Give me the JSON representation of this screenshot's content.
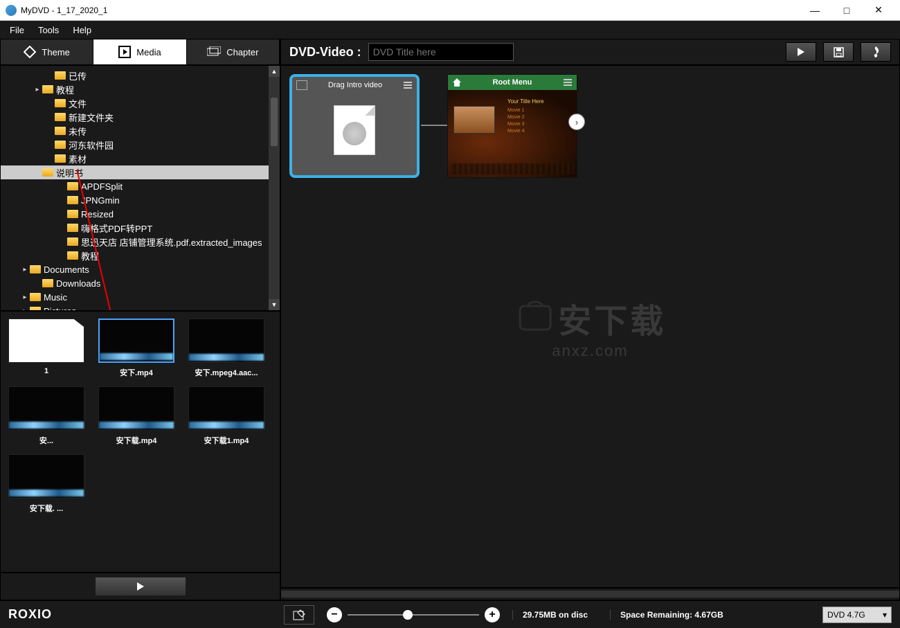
{
  "window": {
    "title": "MyDVD - 1_17_2020_1"
  },
  "menu": {
    "file": "File",
    "tools": "Tools",
    "help": "Help"
  },
  "tabs": {
    "theme": "Theme",
    "media": "Media",
    "chapter": "Chapter"
  },
  "tree": {
    "items": [
      {
        "indent": 3,
        "expand": "",
        "label": "已传"
      },
      {
        "indent": 2,
        "expand": "▸",
        "label": "教程"
      },
      {
        "indent": 3,
        "expand": "",
        "label": "文件"
      },
      {
        "indent": 3,
        "expand": "",
        "label": "新建文件夹"
      },
      {
        "indent": 3,
        "expand": "",
        "label": "未传"
      },
      {
        "indent": 3,
        "expand": "",
        "label": "河东软件园"
      },
      {
        "indent": 3,
        "expand": "",
        "label": "素材"
      },
      {
        "indent": 2,
        "expand": "▾",
        "label": "说明书",
        "selected": true
      },
      {
        "indent": 4,
        "expand": "",
        "label": "APDFSplit"
      },
      {
        "indent": 4,
        "expand": "",
        "label": "JPNGmin"
      },
      {
        "indent": 4,
        "expand": "",
        "label": "Resized"
      },
      {
        "indent": 4,
        "expand": "",
        "label": "嗨格式PDF转PPT"
      },
      {
        "indent": 4,
        "expand": "",
        "label": "思迅天店 店铺管理系统.pdf.extracted_images"
      },
      {
        "indent": 4,
        "expand": "",
        "label": "教程"
      },
      {
        "indent": 1,
        "expand": "▸",
        "label": "Documents"
      },
      {
        "indent": 2,
        "expand": "",
        "label": "Downloads"
      },
      {
        "indent": 1,
        "expand": "▸",
        "label": "Music"
      },
      {
        "indent": 1,
        "expand": "▸",
        "label": "Pictures"
      }
    ]
  },
  "media": {
    "items": [
      {
        "name": "1",
        "kind": "doc"
      },
      {
        "name": "安下.mp4",
        "kind": "video",
        "selected": true
      },
      {
        "name": "安下.mpeg4.aac...",
        "kind": "video"
      },
      {
        "name": "安...",
        "kind": "video"
      },
      {
        "name": "安下载.mp4",
        "kind": "video"
      },
      {
        "name": "安下载1.mp4",
        "kind": "video"
      },
      {
        "name": "安下载. ...",
        "kind": "video"
      }
    ]
  },
  "right": {
    "label": "DVD-Video :",
    "placeholder": "DVD Title here",
    "intro": "Drag Intro video",
    "menu": {
      "title": "Root Menu",
      "subtitle": "Your Title Here",
      "items": [
        "Movie 1",
        "Movie 2",
        "Movie 3",
        "Movie 4"
      ]
    }
  },
  "watermark": {
    "big": "安下载",
    "small": "anxz.com"
  },
  "footer": {
    "brand": "ROXIO",
    "ondisc": "29.75MB on disc",
    "remaining": "Space Remaining: 4.67GB",
    "disc": "DVD 4.7G"
  }
}
